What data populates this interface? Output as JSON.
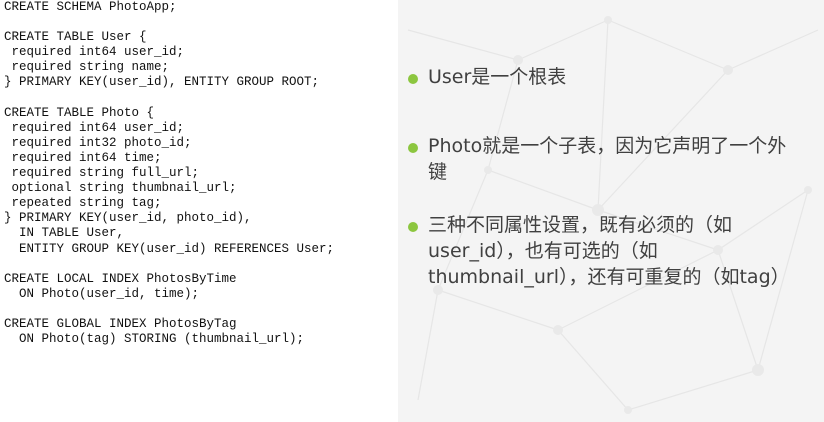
{
  "code": {
    "lines": [
      "CREATE SCHEMA PhotoApp;",
      "",
      "CREATE TABLE User {",
      " required int64 user_id;",
      " required string name;",
      "} PRIMARY KEY(user_id), ENTITY GROUP ROOT;",
      "",
      "CREATE TABLE Photo {",
      " required int64 user_id;",
      " required int32 photo_id;",
      " required int64 time;",
      " required string full_url;",
      " optional string thumbnail_url;",
      " repeated string tag;",
      "} PRIMARY KEY(user_id, photo_id),",
      "  IN TABLE User,",
      "  ENTITY GROUP KEY(user_id) REFERENCES User;",
      "",
      "CREATE LOCAL INDEX PhotosByTime",
      "  ON Photo(user_id, time);",
      "",
      "CREATE GLOBAL INDEX PhotosByTag",
      "  ON Photo(tag) STORING (thumbnail_url);"
    ]
  },
  "bullets": [
    {
      "text": "User是一个根表"
    },
    {
      "text": "Photo就是一个子表，因为它声明了一个外键"
    },
    {
      "text": "三种不同属性设置，既有必须的（如user_id），也有可选的（如thumbnail_url），还有可重复的（如tag）"
    }
  ],
  "colors": {
    "bullet": "#8cc63f",
    "text": "#404040",
    "code": "#111111",
    "background_right": "#f4f4f4"
  }
}
